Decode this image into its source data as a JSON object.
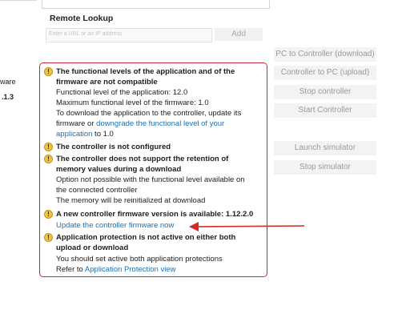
{
  "remote_lookup": {
    "title": "Remote Lookup",
    "url_placeholder": "Enter a URL or an IP address",
    "add_label": "Add"
  },
  "left_partial": {
    "line1": "ware",
    "line2": ".1.3"
  },
  "actions": {
    "pc_to_controller": "PC to Controller (download)",
    "controller_to_pc": "Controller to PC (upload)",
    "stop_controller": "Stop controller",
    "start_controller": "Start Controller",
    "launch_simulator": "Launch simulator",
    "stop_simulator": "Stop simulator"
  },
  "messages": {
    "m1": {
      "title1": "The functional levels of the application and of the",
      "title2": "firmware are not compatible",
      "l1": "Functional level of the application: 12.0",
      "l2": "Maximum functional level of the firmware: 1.0",
      "l3": "To download the application to the controller, update its",
      "l4_pre": "firmware or ",
      "l4_link": "downgrade the functional level of your",
      "l5_link": "application",
      "l5_post": " to 1.0"
    },
    "m2": {
      "title": "The controller is not configured"
    },
    "m3": {
      "title1": "The controller does not support the retention of",
      "title2": "memory values during a download",
      "l1": "Option not possible with the functional level available on",
      "l2": "the connected controller",
      "l3": "The memory will be reinitialized at download"
    },
    "m4": {
      "title": "A new controller firmware version is available: 1.12.2.0",
      "link": "Update the controller firmware now"
    },
    "m5": {
      "title1": "Application protection is not active on either both",
      "title2": "upload or download",
      "l1": "You should set active both application protections",
      "l2_pre": "Refer to ",
      "l2_link": "Application Protection view"
    }
  },
  "icons": {
    "warning": "warning-icon",
    "arrow": "red-arrow-annotation"
  },
  "colors": {
    "panel_border": "#c4283a",
    "link": "#1b6fb5",
    "warning": "#f4c33d"
  }
}
